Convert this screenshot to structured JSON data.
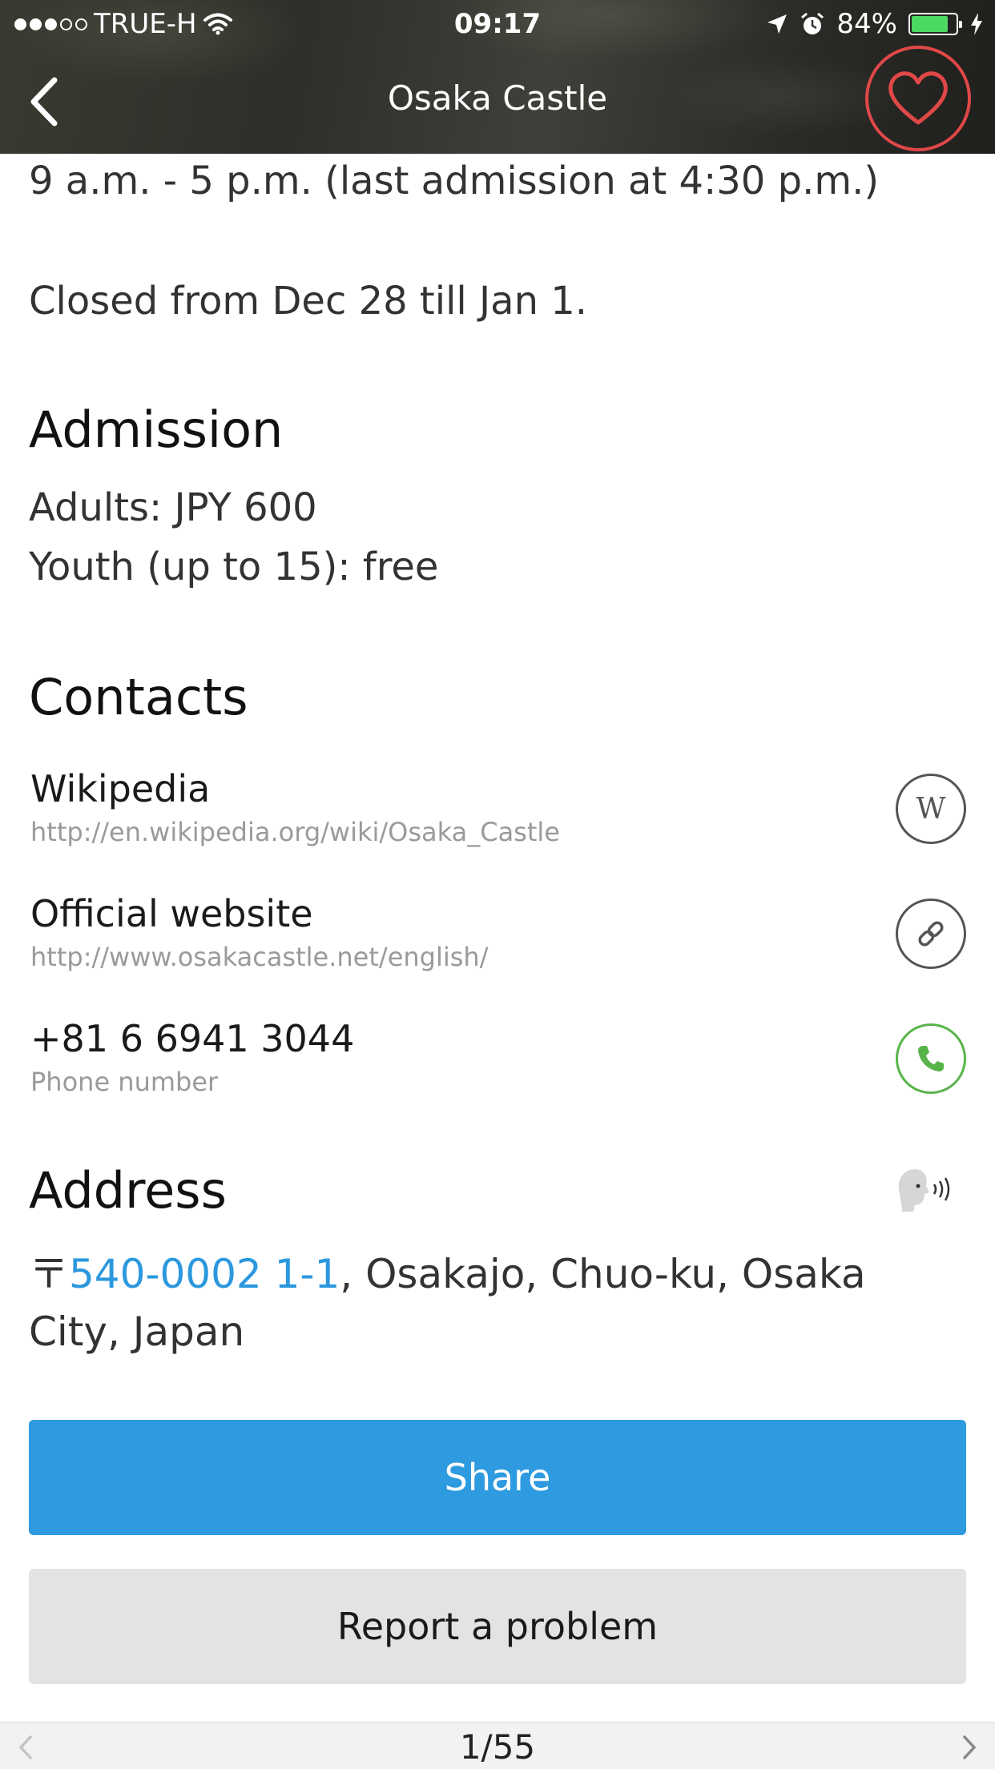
{
  "status_bar": {
    "carrier": "TRUE-H",
    "time": "09:17",
    "battery": "84%",
    "battery_level": 0.84,
    "battery_color": "#4cd964",
    "signal_bars_filled": 3,
    "signal_bars_total": 5,
    "icons": [
      "wifi-icon",
      "location-arrow-icon",
      "alarm-icon",
      "charging-bolt-icon"
    ]
  },
  "nav": {
    "title": "Osaka Castle",
    "back_icon": "chevron-left-icon",
    "favorite_icon": "heart-icon",
    "favorite_color": "#e04848"
  },
  "hours": {
    "line1": "9 a.m. - 5 p.m. (last admission at 4:30 p.m.)",
    "line2": "Closed from Dec 28 till Jan 1."
  },
  "admission": {
    "heading": "Admission",
    "line1": "Adults: JPY 600",
    "line2": "Youth (up to 15): free"
  },
  "contacts": {
    "heading": "Contacts",
    "items": [
      {
        "label": "Wikipedia",
        "sub": "http://en.wikipedia.org/wiki/Osaka_Castle",
        "icon": "wikipedia-icon"
      },
      {
        "label": "Official website",
        "sub": "http://www.osakacastle.net/english/",
        "icon": "link-icon"
      },
      {
        "label": "+81 6 6941 3044",
        "sub": "Phone number",
        "icon": "phone-icon",
        "icon_color": "#58b44a"
      }
    ]
  },
  "address": {
    "heading": "Address",
    "postal_mark": "〒",
    "link_text": "540-0002 1-1",
    "rest": ", Osakajo, Chuo-ku, Osaka City, Japan",
    "link_color": "#2b98de",
    "speak_icon": "speak-icon"
  },
  "buttons": {
    "share": "Share",
    "share_color": "#2e9adf",
    "report": "Report a problem"
  },
  "pager": {
    "text": "1/55",
    "prev_icon": "chevron-left-icon",
    "next_icon": "chevron-right-icon"
  }
}
